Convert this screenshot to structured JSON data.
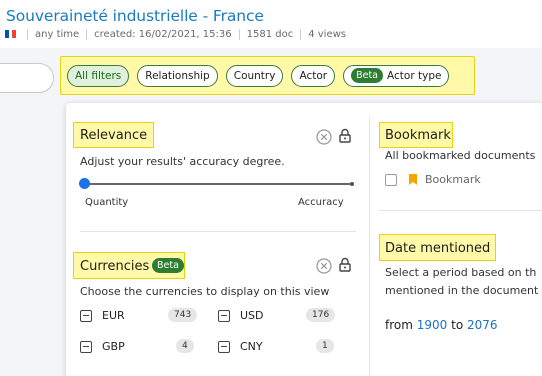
{
  "header": {
    "title": "Souveraineté industrielle - France",
    "meta": [
      "any time",
      "created: 16/02/2021, 15:36",
      "1581 doc",
      "4 views"
    ]
  },
  "filters": {
    "chips": [
      {
        "label": "All filters",
        "active": true
      },
      {
        "label": "Relationship"
      },
      {
        "label": "Country"
      },
      {
        "label": "Actor"
      },
      {
        "label": "Actor type",
        "badge": "Beta"
      }
    ]
  },
  "relevance": {
    "title": "Relevance",
    "description": "Adjust your results' accuracy degree.",
    "left_label": "Quantity",
    "right_label": "Accuracy",
    "slider_value": 0
  },
  "currencies": {
    "title": "Currencies",
    "badge": "Beta",
    "description": "Choose the currencies to display on this view",
    "items": [
      {
        "code": "EUR",
        "count": "743"
      },
      {
        "code": "USD",
        "count": "176"
      },
      {
        "code": "GBP",
        "count": "4"
      },
      {
        "code": "CNY",
        "count": "1"
      }
    ]
  },
  "bookmark": {
    "title": "Bookmark",
    "description": "All bookmarked documents",
    "option": "Bookmark"
  },
  "date_mentioned": {
    "title": "Date mentioned",
    "description_line1": "Select a period based on th",
    "description_line2": "mentioned in the document",
    "from_label": "from",
    "from_value": "1900",
    "to_label": "to",
    "to_value": "2076"
  },
  "colors": {
    "title_blue": "#1a7bbd",
    "highlight": "#fff9a8",
    "beta_green": "#2e7d32",
    "slider_blue": "#1a73e8",
    "bookmark_orange": "#f5a400"
  }
}
